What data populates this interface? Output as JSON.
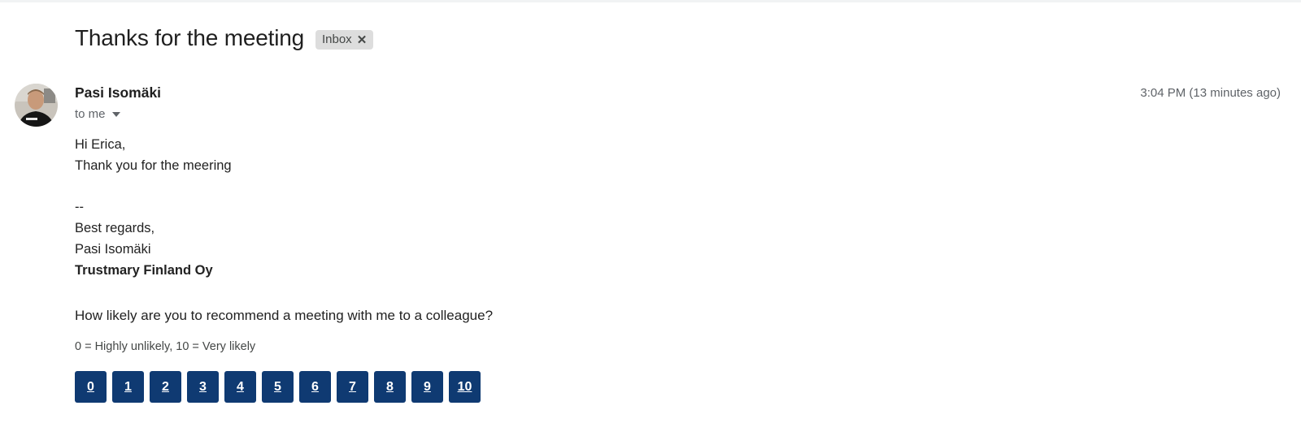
{
  "message": {
    "subject": "Thanks for the meeting",
    "label": "Inbox",
    "label_remove_icon": "close-icon",
    "sender_name": "Pasi Isomäki",
    "recipient_text": "to me",
    "timestamp": "3:04 PM (13 minutes ago)"
  },
  "body": {
    "greeting": "Hi Erica,",
    "line1": "Thank you for the meering",
    "separator": "--",
    "signoff": "Best regards,",
    "signature_name": "Pasi Isomäki",
    "company": "Trustmary Finland Oy"
  },
  "survey": {
    "question": "How likely are you to recommend a meeting with me to a colleague?",
    "scale_note": "0 = Highly unlikely, 10 = Very likely",
    "options": [
      "0",
      "1",
      "2",
      "3",
      "4",
      "5",
      "6",
      "7",
      "8",
      "9",
      "10"
    ]
  },
  "colors": {
    "rating_button": "#0f3a72",
    "label_chip": "#dddddd"
  }
}
